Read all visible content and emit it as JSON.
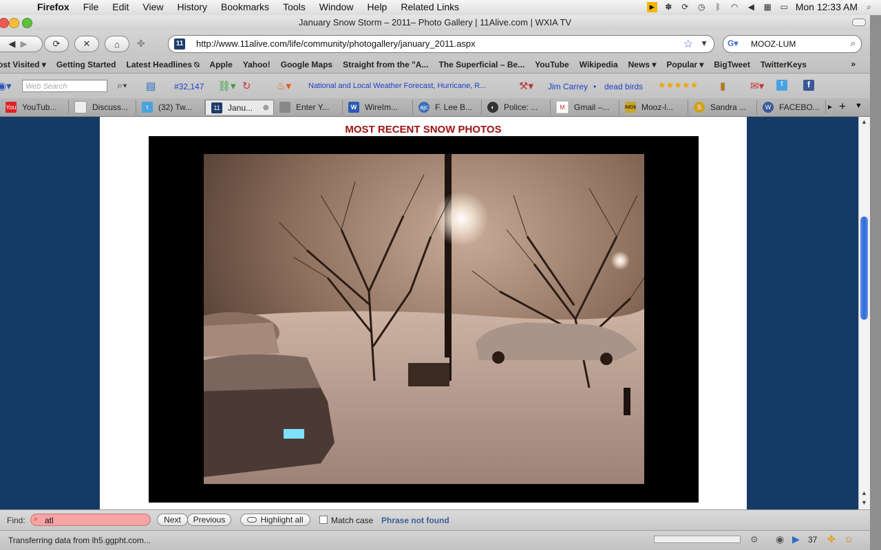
{
  "menubar": {
    "items": [
      "Firefox",
      "File",
      "Edit",
      "View",
      "History",
      "Bookmarks",
      "Tools",
      "Window",
      "Help",
      "Related Links"
    ],
    "clock": "Mon 12:33 AM"
  },
  "window": {
    "title": "January Snow Storm – 2011– Photo Gallery | 11Alive.com | WXIA TV"
  },
  "nav": {
    "url": "http://www.11alive.com/life/community/photogallery/january_2011.aspx",
    "search_value": "MOOZ-LUM",
    "site_badge": "11"
  },
  "bookmarks": [
    "ost Visited ▾",
    "Getting Started",
    "Latest Headlines ⍉",
    "Apple",
    "Yahoo!",
    "Google Maps",
    "Straight from the \"A...",
    "The Superficial – Be...",
    "YouTube",
    "Wikipedia",
    "News ▾",
    "Popular ▾",
    "BigTweet",
    "TwitterKeys"
  ],
  "addons": {
    "web_search_placeholder": "Web Search",
    "counter": "#32,147",
    "weather_link": "National and Local Weather Forecast, Hurricane, R...",
    "link_jim": "Jim Carrey",
    "link_birds": "dead birds",
    "stars": "★★★★★"
  },
  "tabs": [
    {
      "label": "YouTub...",
      "color": "#d22"
    },
    {
      "label": "Discuss...",
      "color": "#ddd"
    },
    {
      "label": "(32) Tw...",
      "color": "#4aa3df"
    },
    {
      "label": "Janu...",
      "color": "#1e3c6e",
      "active": true
    },
    {
      "label": "Enter Y...",
      "color": "#888"
    },
    {
      "label": "WireIm...",
      "color": "#2a5bb5"
    },
    {
      "label": "F. Lee B...",
      "color": "#3b6fb7"
    },
    {
      "label": "Police: ...",
      "color": "#333"
    },
    {
      "label": "Gmail –...",
      "color": "#c33"
    },
    {
      "label": "Mooz-l...",
      "color": "#c9a42a"
    },
    {
      "label": "Sandra ...",
      "color": "#d4a020"
    },
    {
      "label": "FACEBO...",
      "color": "#3b5998"
    }
  ],
  "page": {
    "heading": "MOST RECENT SNOW PHOTOS"
  },
  "findbar": {
    "label": "Find:",
    "value": "atl",
    "next": "Next",
    "previous": "Previous",
    "highlight": "Highlight all",
    "match_case": "Match case",
    "status": "Phrase not found"
  },
  "status": {
    "text": "Transferring data from lh5.ggpht.com...",
    "count": "37"
  }
}
